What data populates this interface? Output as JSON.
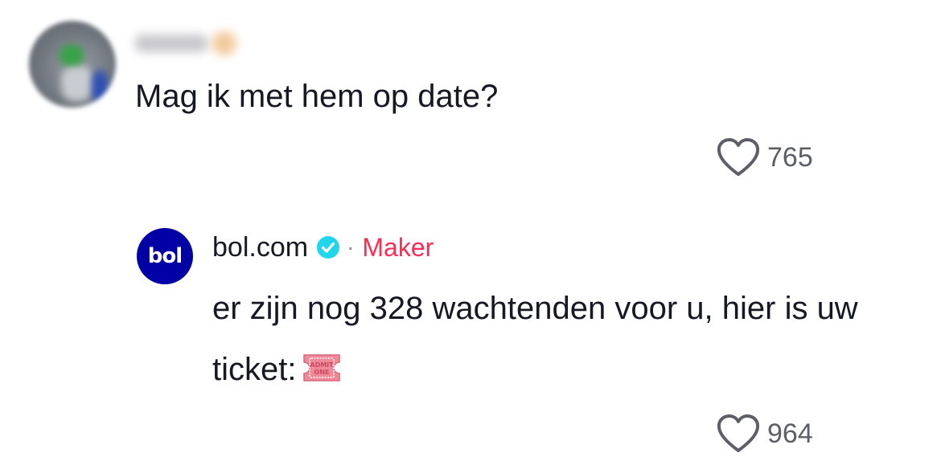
{
  "comment": {
    "text": "Mag ik met hem op date?",
    "likes": "765"
  },
  "reply": {
    "avatar_text": "bol",
    "author": "bol.com",
    "separator": "·",
    "badge": "Maker",
    "text": "er zijn nog 328 wachtenden voor u, hier is uw ticket:",
    "ticket_line1": "ADMIT",
    "ticket_line2": "ONE",
    "likes": "964"
  },
  "icons": {
    "like": "heart-outline-icon",
    "verified": "verified-check-icon",
    "ticket": "admission-ticket-emoji"
  },
  "colors": {
    "accent": "#fe2c55",
    "verified": "#20d5ec",
    "brand": "#0000a4",
    "text": "#161823",
    "muted": "#5e5f66"
  }
}
